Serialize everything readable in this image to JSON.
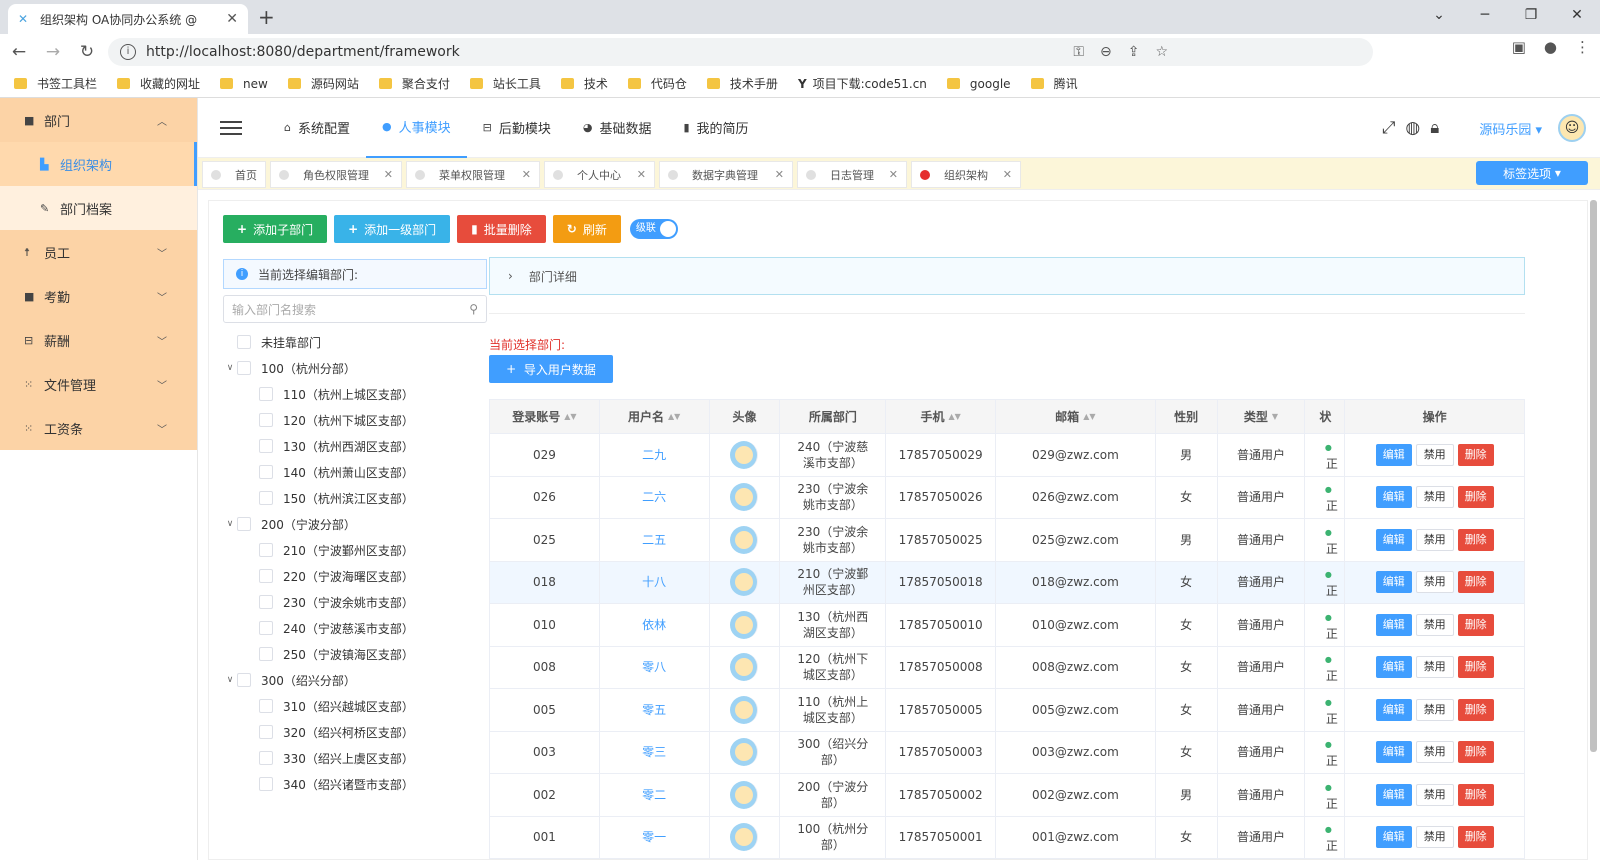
{
  "browser": {
    "tab_title": "组织架构 OA协同办公系统 @",
    "url": "http://localhost:8080/department/framework",
    "bookmarks": [
      "书签工具栏",
      "收藏的网址",
      "new",
      "源码网站",
      "聚合支付",
      "站长工具",
      "技术",
      "代码仓",
      "技术手册",
      "项目下载:code51.cn",
      "google",
      "腾讯"
    ]
  },
  "sidebar": {
    "items": [
      {
        "label": "部门",
        "icon": "square-icon",
        "expanded": true
      },
      {
        "label": "组织架构",
        "icon": "grid-icon",
        "active": true
      },
      {
        "label": "部门档案",
        "icon": "pen-icon"
      },
      {
        "label": "员工",
        "icon": "person-icon"
      },
      {
        "label": "考勤",
        "icon": "square-icon"
      },
      {
        "label": "薪酬",
        "icon": "lock-icon"
      },
      {
        "label": "文件管理",
        "icon": "apps-icon"
      },
      {
        "label": "工资条",
        "icon": "apps-icon"
      }
    ]
  },
  "header": {
    "nav": [
      {
        "label": "系统配置",
        "icon": "home-icon"
      },
      {
        "label": "人事模块",
        "icon": "people-icon",
        "active": true
      },
      {
        "label": "后勤模块",
        "icon": "lock-icon"
      },
      {
        "label": "基础数据",
        "icon": "pie-icon"
      },
      {
        "label": "我的简历",
        "icon": "book-icon"
      }
    ],
    "user": "源码乐园"
  },
  "tags": {
    "items": [
      "首页",
      "角色权限管理",
      "菜单权限管理",
      "个人中心",
      "数据字典管理",
      "日志管理",
      "组织架构"
    ],
    "options_label": "标签选项"
  },
  "toolbar": {
    "add_child": "添加子部门",
    "add_top": "添加一级部门",
    "batch_delete": "批量删除",
    "refresh": "刷新",
    "cascade": "级联"
  },
  "tree": {
    "alert": "当前选择编辑部门:",
    "search_placeholder": "输入部门名搜索",
    "nodes": [
      {
        "label": "未挂靠部门",
        "level": 0,
        "expand": false
      },
      {
        "label": "100（杭州分部）",
        "level": 0,
        "expand": true
      },
      {
        "label": "110（杭州上城区支部）",
        "level": 1
      },
      {
        "label": "120（杭州下城区支部）",
        "level": 1
      },
      {
        "label": "130（杭州西湖区支部）",
        "level": 1
      },
      {
        "label": "140（杭州萧山区支部）",
        "level": 1
      },
      {
        "label": "150（杭州滨江区支部）",
        "level": 1
      },
      {
        "label": "200（宁波分部）",
        "level": 0,
        "expand": true
      },
      {
        "label": "210（宁波鄞州区支部）",
        "level": 1
      },
      {
        "label": "220（宁波海曙区支部）",
        "level": 1
      },
      {
        "label": "230（宁波余姚市支部）",
        "level": 1
      },
      {
        "label": "240（宁波慈溪市支部）",
        "level": 1
      },
      {
        "label": "250（宁波镇海区支部）",
        "level": 1
      },
      {
        "label": "300（绍兴分部）",
        "level": 0,
        "expand": true
      },
      {
        "label": "310（绍兴越城区支部）",
        "level": 1
      },
      {
        "label": "320（绍兴柯桥区支部）",
        "level": 1
      },
      {
        "label": "330（绍兴上虞区支部）",
        "level": 1
      },
      {
        "label": "340（绍兴诸暨市支部）",
        "level": 1
      }
    ]
  },
  "detail": {
    "collapse_title": "部门详细",
    "current_label": "当前选择部门:",
    "import_label": "导入用户数据"
  },
  "table": {
    "headers": [
      "登录账号",
      "用户名",
      "头像",
      "所属部门",
      "手机",
      "邮箱",
      "性别",
      "类型",
      "状",
      "操作"
    ],
    "actions": {
      "edit": "编辑",
      "disable": "禁用",
      "delete": "删除"
    },
    "rows": [
      {
        "account": "029",
        "name": "二九",
        "dept": "240（宁波慈溪市支部）",
        "phone": "17857050029",
        "email": "029@zwz.com",
        "gender": "男",
        "type": "普通用户",
        "status": "正"
      },
      {
        "account": "026",
        "name": "二六",
        "dept": "230（宁波余姚市支部）",
        "phone": "17857050026",
        "email": "026@zwz.com",
        "gender": "女",
        "type": "普通用户",
        "status": "正"
      },
      {
        "account": "025",
        "name": "二五",
        "dept": "230（宁波余姚市支部）",
        "phone": "17857050025",
        "email": "025@zwz.com",
        "gender": "男",
        "type": "普通用户",
        "status": "正"
      },
      {
        "account": "018",
        "name": "十八",
        "dept": "210（宁波鄞州区支部）",
        "phone": "17857050018",
        "email": "018@zwz.com",
        "gender": "女",
        "type": "普通用户",
        "status": "正"
      },
      {
        "account": "010",
        "name": "依林",
        "dept": "130（杭州西湖区支部）",
        "phone": "17857050010",
        "email": "010@zwz.com",
        "gender": "女",
        "type": "普通用户",
        "status": "正"
      },
      {
        "account": "008",
        "name": "零八",
        "dept": "120（杭州下城区支部）",
        "phone": "17857050008",
        "email": "008@zwz.com",
        "gender": "女",
        "type": "普通用户",
        "status": "正"
      },
      {
        "account": "005",
        "name": "零五",
        "dept": "110（杭州上城区支部）",
        "phone": "17857050005",
        "email": "005@zwz.com",
        "gender": "女",
        "type": "普通用户",
        "status": "正"
      },
      {
        "account": "003",
        "name": "零三",
        "dept": "300（绍兴分部）",
        "phone": "17857050003",
        "email": "003@zwz.com",
        "gender": "女",
        "type": "普通用户",
        "status": "正"
      },
      {
        "account": "002",
        "name": "零二",
        "dept": "200（宁波分部）",
        "phone": "17857050002",
        "email": "002@zwz.com",
        "gender": "男",
        "type": "普通用户",
        "status": "正"
      },
      {
        "account": "001",
        "name": "零一",
        "dept": "100（杭州分部）",
        "phone": "17857050001",
        "email": "001@zwz.com",
        "gender": "女",
        "type": "普通用户",
        "status": "正"
      }
    ]
  }
}
